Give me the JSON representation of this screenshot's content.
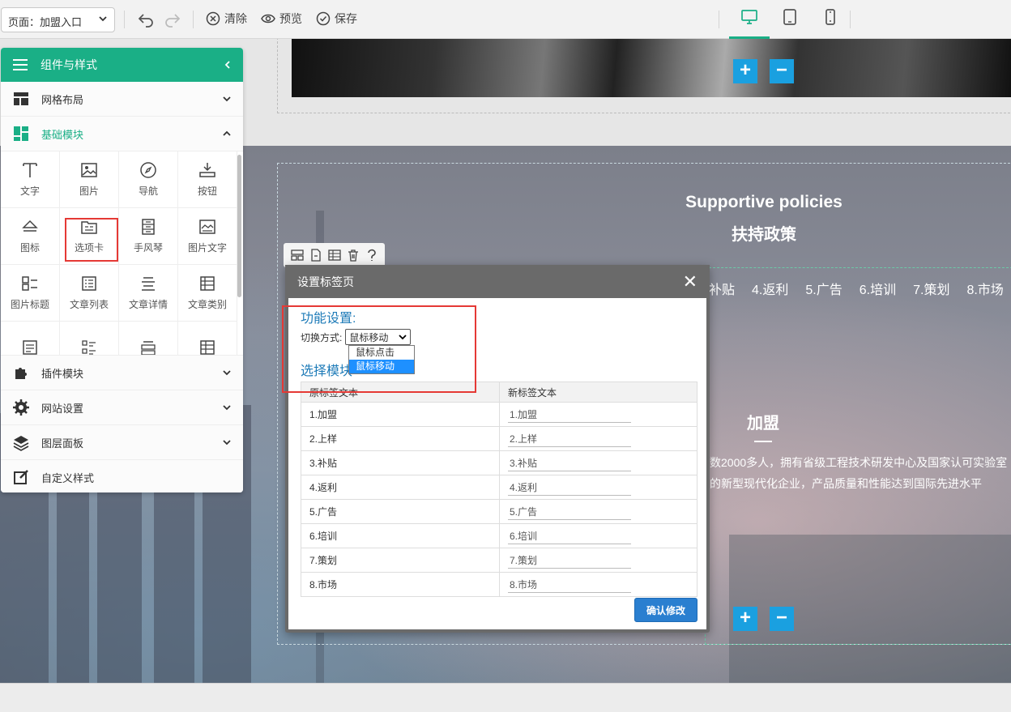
{
  "toolbar": {
    "page_select": "页面：加盟入口",
    "clear_label": "清除",
    "preview_label": "预览",
    "save_label": "保存"
  },
  "panel": {
    "title": "组件与样式",
    "sections": {
      "grid_layout": "网格布局",
      "basic_modules": "基础模块",
      "plugin_modules": "插件模块",
      "site_settings": "网站设置",
      "layer_panel": "图层面板",
      "custom_style": "自定义样式"
    },
    "modules": [
      {
        "label": "文字",
        "icon": "text-icon"
      },
      {
        "label": "图片",
        "icon": "image-icon"
      },
      {
        "label": "导航",
        "icon": "compass-icon"
      },
      {
        "label": "按钮",
        "icon": "button-icon"
      },
      {
        "label": "图标",
        "icon": "shape-icon"
      },
      {
        "label": "选项卡",
        "icon": "tabs-icon"
      },
      {
        "label": "手风琴",
        "icon": "accordion-icon"
      },
      {
        "label": "图片文字",
        "icon": "image-text-icon"
      },
      {
        "label": "图片标题",
        "icon": "image-title-icon"
      },
      {
        "label": "文章列表",
        "icon": "article-list-icon"
      },
      {
        "label": "文章详情",
        "icon": "article-detail-icon"
      },
      {
        "label": "文章类别",
        "icon": "article-category-icon"
      },
      {
        "label": "",
        "icon": "doc-icon"
      },
      {
        "label": "",
        "icon": "list-icon"
      },
      {
        "label": "",
        "icon": "card-icon"
      },
      {
        "label": "",
        "icon": "table-icon"
      }
    ]
  },
  "page": {
    "title_en": "Supportive policies",
    "title_cn": "扶持政策",
    "tabs": [
      "补贴",
      "4.返利",
      "5.广告",
      "6.培训",
      "7.策划",
      "8.市场"
    ],
    "join_title": "加盟",
    "join_text_1": "数2000多人，拥有省级工程技术研发中心及国家认可实验室",
    "join_text_2": "的新型现代化企业，产品质量和性能达到国际先进水平"
  },
  "modal": {
    "title": "设置标签页",
    "section_function": "功能设置:",
    "switch_label": "切换方式:",
    "switch_value": "鼠标移动",
    "switch_options": [
      "鼠标点击",
      "鼠标移动"
    ],
    "section_select": "选择模块",
    "col_original": "原标签文本",
    "col_new": "新标签文本",
    "rows": [
      {
        "original": "1.加盟",
        "new": "1.加盟"
      },
      {
        "original": "2.上样",
        "new": "2.上样"
      },
      {
        "original": "3.补贴",
        "new": "3.补贴"
      },
      {
        "original": "4.返利",
        "new": "4.返利"
      },
      {
        "original": "5.广告",
        "new": "5.广告"
      },
      {
        "original": "6.培训",
        "new": "6.培训"
      },
      {
        "original": "7.策划",
        "new": "7.策划"
      },
      {
        "original": "8.市场",
        "new": "8.市场"
      }
    ],
    "confirm_label": "确认修改"
  },
  "colors": {
    "accent": "#1aaf86",
    "modal_header": "#6a6a6a",
    "link_blue": "#1e7bb8",
    "confirm_button": "#2a7fd0",
    "highlight_red": "#e53935",
    "plus_minus": "#1aa0e0"
  }
}
